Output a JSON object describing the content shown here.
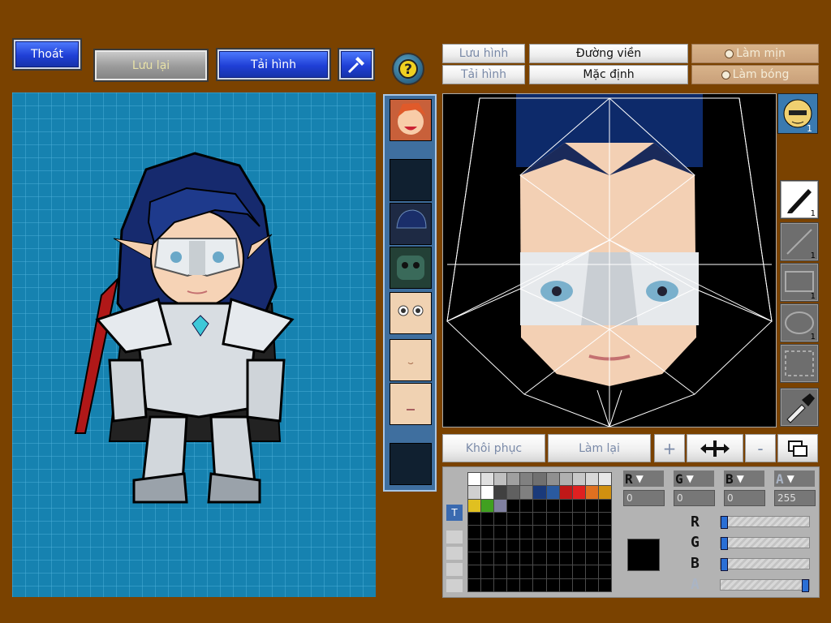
{
  "toolbar": {
    "exit_label": "Thoát",
    "save_label": "Lưu lại",
    "load_image_label": "Tải hình"
  },
  "editor": {
    "save_image_label": "Lưu hình",
    "load_image_label": "Tải hình",
    "outline_label": "Đường viền",
    "default_label": "Mặc định",
    "smooth_label": "Làm mịn",
    "shading_label": "Làm bóng",
    "restore_label": "Khôi phục",
    "redo_label": "Làm lại",
    "zoom_in_symbol": "+",
    "zoom_out_symbol": "-"
  },
  "tools": {
    "pen_count": "1",
    "line_count": "1",
    "rect_count": "1",
    "ellipse_count": "1"
  },
  "color": {
    "labels": {
      "r": "R",
      "g": "G",
      "b": "B",
      "a": "A"
    },
    "values": {
      "r": "0",
      "g": "0",
      "b": "0",
      "a": "255"
    },
    "levels": {
      "r": 0,
      "g": 0,
      "b": 0,
      "a": 1
    },
    "current": "#000000",
    "palette_row1": [
      "#ffffff",
      "#e0e0e0",
      "#c0c0c0",
      "#a0a0a0",
      "#808080",
      "#707070",
      "#909090",
      "#b0b0b0",
      "#c8c8c8",
      "#d8d8d8",
      "#e8e8e8"
    ],
    "palette_row2": [
      "#d0d0d0",
      "#ffffff",
      "#404040",
      "#606060",
      "#808080",
      "#1a3a7a",
      "#2a5aa0",
      "#c01818",
      "#e02020",
      "#e07020",
      "#d09010"
    ],
    "palette_row3": [
      "#e0c020",
      "#40a020",
      "#8080a0"
    ]
  },
  "palette_tab_label": "T",
  "accent_colors": {
    "panel_bg": "#7a4200",
    "preview_bg": "#1682b0",
    "button_blue": "#1f3fd6"
  },
  "icons": [
    "hammer-icon",
    "help-icon",
    "pen-icon",
    "line-icon",
    "rect-icon",
    "ellipse-icon",
    "select-icon",
    "eyedropper-icon",
    "move-icon",
    "layers-icon"
  ]
}
